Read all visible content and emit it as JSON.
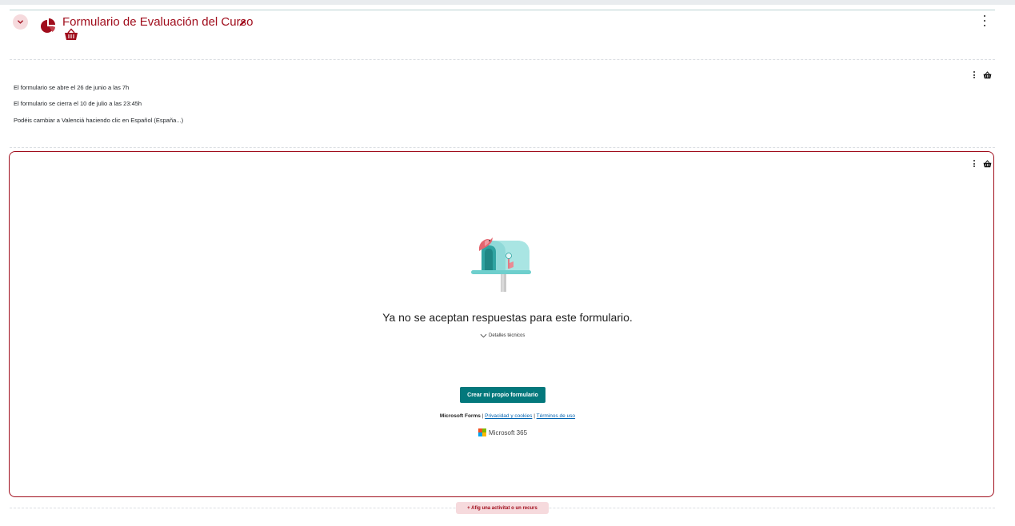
{
  "section": {
    "title": "Formulario de Evaluación del Curso"
  },
  "info": {
    "line1": "El formulario se abre el 26 de junio a las 7h",
    "line2": "El formulario se cierra el 10 de julio a las 23:45h",
    "line3": "Podéis cambiar a Valenciá haciendo clic en Español (España...)"
  },
  "form": {
    "closed_message": "Ya no se aceptan respuestas para este formulario.",
    "details_label": "Detalles técnicos",
    "create_button": "Crear mi propio formulario",
    "brand": "Microsoft Forms",
    "separator": "|",
    "privacy_link": "Privacidad y cookies",
    "terms_link": "Términos de uso",
    "ms365_label": "Microsoft 365"
  },
  "footer": {
    "add_activity": "+ Afig una activitat o un recurs"
  },
  "colors": {
    "accent": "#a00d1c",
    "accent_light": "#f6dadd",
    "forms_teal": "#03787c"
  },
  "icons": [
    "chevron-down-icon",
    "pie-chart-icon",
    "pencil-icon",
    "basket-icon",
    "kebab-menu-icon",
    "mailbox-illustration",
    "microsoft-logo-icon"
  ]
}
